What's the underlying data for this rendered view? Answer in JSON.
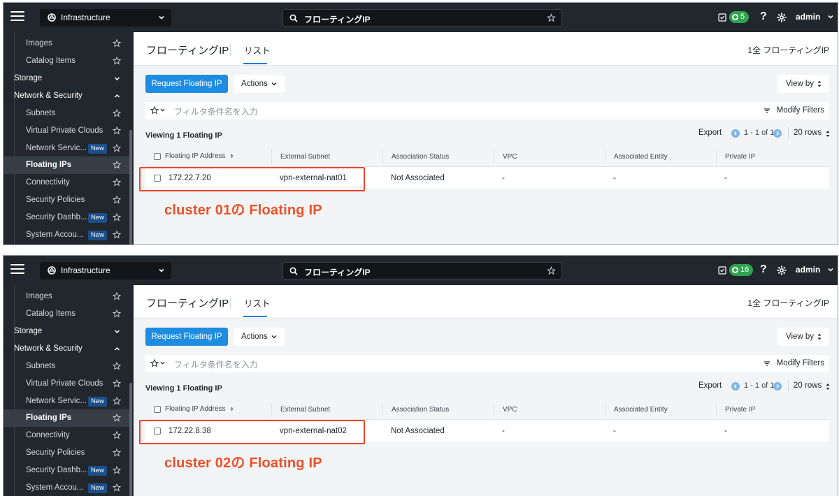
{
  "panels": [
    {
      "topbar": {
        "app_label": "Infrastructure",
        "search_text": "フローティングIP",
        "task_count": "5",
        "help": "?",
        "user": "admin"
      },
      "sidebar": {
        "items": [
          {
            "label": "Images",
            "type": "child"
          },
          {
            "label": "Catalog Items",
            "type": "child"
          },
          {
            "label": "Storage",
            "type": "section",
            "chevron": "down"
          },
          {
            "label": "Network & Security",
            "type": "section",
            "chevron": "up"
          },
          {
            "label": "Subnets",
            "type": "child"
          },
          {
            "label": "Virtual Private Clouds",
            "type": "child"
          },
          {
            "label": "Network Servic...",
            "type": "child",
            "badge": "New"
          },
          {
            "label": "Floating IPs",
            "type": "child",
            "active": true
          },
          {
            "label": "Connectivity",
            "type": "child"
          },
          {
            "label": "Security Policies",
            "type": "child"
          },
          {
            "label": "Security Dashb...",
            "type": "child",
            "badge": "New"
          },
          {
            "label": "System Accou...",
            "type": "child",
            "badge": "New"
          }
        ]
      },
      "page": {
        "title": "フローティングIP",
        "tab": "リスト",
        "count": "1全 フローティングIP",
        "request_button": "Request Floating IP",
        "actions_button": "Actions",
        "view_by": "View by",
        "filter_placeholder": "フィルタ条件名を入力",
        "modify_filters": "Modify Filters",
        "viewing": "Viewing 1 Floating IP",
        "export": "Export",
        "pagination": "1 - 1 of 1",
        "rows": "20 rows",
        "columns": [
          "Floating IP Address",
          "External Subnet",
          "Association Status",
          "VPC",
          "Associated Entity",
          "Private IP"
        ],
        "rows_data": [
          [
            "172.22.7.20",
            "vpn-external-nat01",
            "Not Associated",
            "-",
            "-",
            "-"
          ]
        ]
      },
      "annotation": "cluster 01の Floating IP"
    },
    {
      "topbar": {
        "app_label": "Infrastructure",
        "search_text": "フローティングIP",
        "task_count": "16",
        "help": "?",
        "user": "admin"
      },
      "sidebar": {
        "items": [
          {
            "label": "Images",
            "type": "child"
          },
          {
            "label": "Catalog Items",
            "type": "child"
          },
          {
            "label": "Storage",
            "type": "section",
            "chevron": "down"
          },
          {
            "label": "Network & Security",
            "type": "section",
            "chevron": "up"
          },
          {
            "label": "Subnets",
            "type": "child"
          },
          {
            "label": "Virtual Private Clouds",
            "type": "child"
          },
          {
            "label": "Network Servic...",
            "type": "child",
            "badge": "New"
          },
          {
            "label": "Floating IPs",
            "type": "child",
            "active": true
          },
          {
            "label": "Connectivity",
            "type": "child"
          },
          {
            "label": "Security Policies",
            "type": "child"
          },
          {
            "label": "Security Dashb...",
            "type": "child",
            "badge": "New"
          },
          {
            "label": "System Accou...",
            "type": "child",
            "badge": "New"
          }
        ]
      },
      "page": {
        "title": "フローティングIP",
        "tab": "リスト",
        "count": "1全 フローティングIP",
        "request_button": "Request Floating IP",
        "actions_button": "Actions",
        "view_by": "View by",
        "filter_placeholder": "フィルタ条件名を入力",
        "modify_filters": "Modify Filters",
        "viewing": "Viewing 1 Floating IP",
        "export": "Export",
        "pagination": "1 - 1 of 1",
        "rows": "20 rows",
        "columns": [
          "Floating IP Address",
          "External Subnet",
          "Association Status",
          "VPC",
          "Associated Entity",
          "Private IP"
        ],
        "rows_data": [
          [
            "172.22.8.38",
            "vpn-external-nat02",
            "Not Associated",
            "-",
            "-",
            "-"
          ]
        ]
      },
      "annotation": "cluster 02の Floating IP"
    }
  ],
  "colors": {
    "topbar": "#22272e",
    "primary_button": "#1e8ce0",
    "task_badge": "#2ea44f",
    "highlight": "#e8462a",
    "annotation": "#ee5028"
  }
}
